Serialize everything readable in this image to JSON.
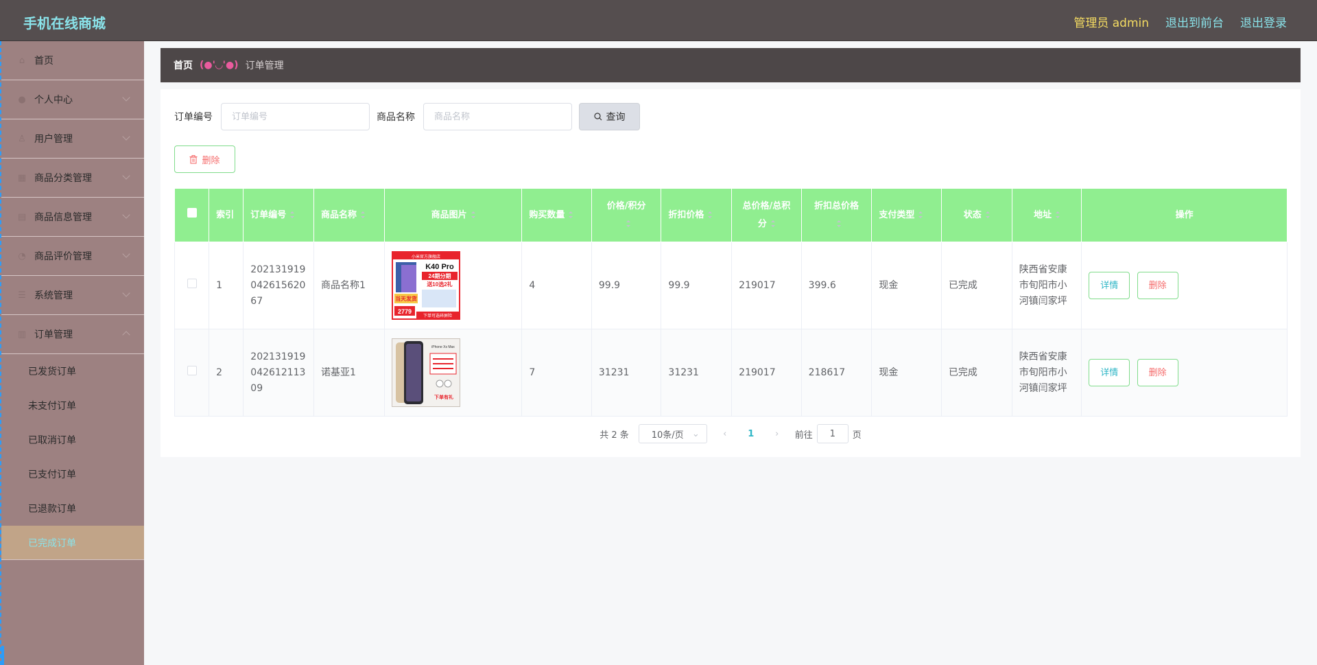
{
  "app": {
    "title": "手机在线商城",
    "user_label": "管理员 admin",
    "front_link": "退出到前台",
    "logout_link": "退出登录"
  },
  "sidebar": {
    "items": [
      {
        "label": "首页",
        "icon": "home-icon"
      },
      {
        "label": "个人中心",
        "icon": "user-icon"
      },
      {
        "label": "用户管理",
        "icon": "users-icon"
      },
      {
        "label": "商品分类管理",
        "icon": "category-icon"
      },
      {
        "label": "商品信息管理",
        "icon": "product-icon"
      },
      {
        "label": "商品评价管理",
        "icon": "review-icon"
      },
      {
        "label": "系统管理",
        "icon": "settings-icon"
      },
      {
        "label": "订单管理",
        "icon": "orders-icon"
      }
    ],
    "sub_items": [
      {
        "label": "已发货订单"
      },
      {
        "label": "未支付订单"
      },
      {
        "label": "已取消订单"
      },
      {
        "label": "已支付订单"
      },
      {
        "label": "已退款订单"
      },
      {
        "label": "已完成订单"
      }
    ]
  },
  "breadcrumb": {
    "home": "首页",
    "separator": "(●'◡'●)",
    "current": "订单管理"
  },
  "search": {
    "order_label": "订单编号",
    "order_placeholder": "订单编号",
    "product_label": "商品名称",
    "product_placeholder": "商品名称",
    "query_button": "查询"
  },
  "actions": {
    "delete_button": "删除"
  },
  "table": {
    "headers": [
      "索引",
      "订单编号",
      "商品名称",
      "商品图片",
      "购买数量",
      "价格/积分",
      "折扣价格",
      "总价格/总积分",
      "折扣总价格",
      "支付类型",
      "状态",
      "地址",
      "操作"
    ],
    "rows": [
      {
        "index": "1",
        "order_no": "202131919042615620 67",
        "product": "商品名称1",
        "image": "phone-k40-promo",
        "qty": "4",
        "price": "99.9",
        "discount_price": "99.9",
        "total": "219017",
        "discount_total": "399.6",
        "pay_type": "现金",
        "status": "已完成",
        "address": "陕西省安康市旬阳市小河镇闫家坪",
        "detail_button": "详情",
        "delete_button": "删除"
      },
      {
        "index": "2",
        "order_no": "202131919042612113 09",
        "product": "诺基亚1",
        "image": "iphone-xs-promo",
        "qty": "7",
        "price": "31231",
        "discount_price": "31231",
        "total": "219017",
        "discount_total": "218617",
        "pay_type": "现金",
        "status": "已完成",
        "address": "陕西省安康市旬阳市小河镇闫家坪",
        "detail_button": "详情",
        "delete_button": "删除"
      }
    ]
  },
  "image_text": {
    "row1": {
      "store": "小米官方旗舰店",
      "model": "K40 Pro",
      "promo1": "24期分期",
      "promo2": "送10选2礼",
      "promo3": "当天发货",
      "price": "2779",
      "footer": "下单可选碎屏险"
    },
    "row2": {
      "brand": "iPhone Xs Max",
      "promo": "下单有礼"
    }
  },
  "pagination": {
    "total": "共 2 条",
    "page_size": "10条/页",
    "current_page": "1",
    "goto_prefix": "前往",
    "goto_value": "1",
    "goto_suffix": "页"
  },
  "colors": {
    "topbar": "#554e4f",
    "brand": "#8ae3ea",
    "sidebar": "#9d8181",
    "table_header": "#90ee90",
    "accent": "#2fb6c6"
  }
}
